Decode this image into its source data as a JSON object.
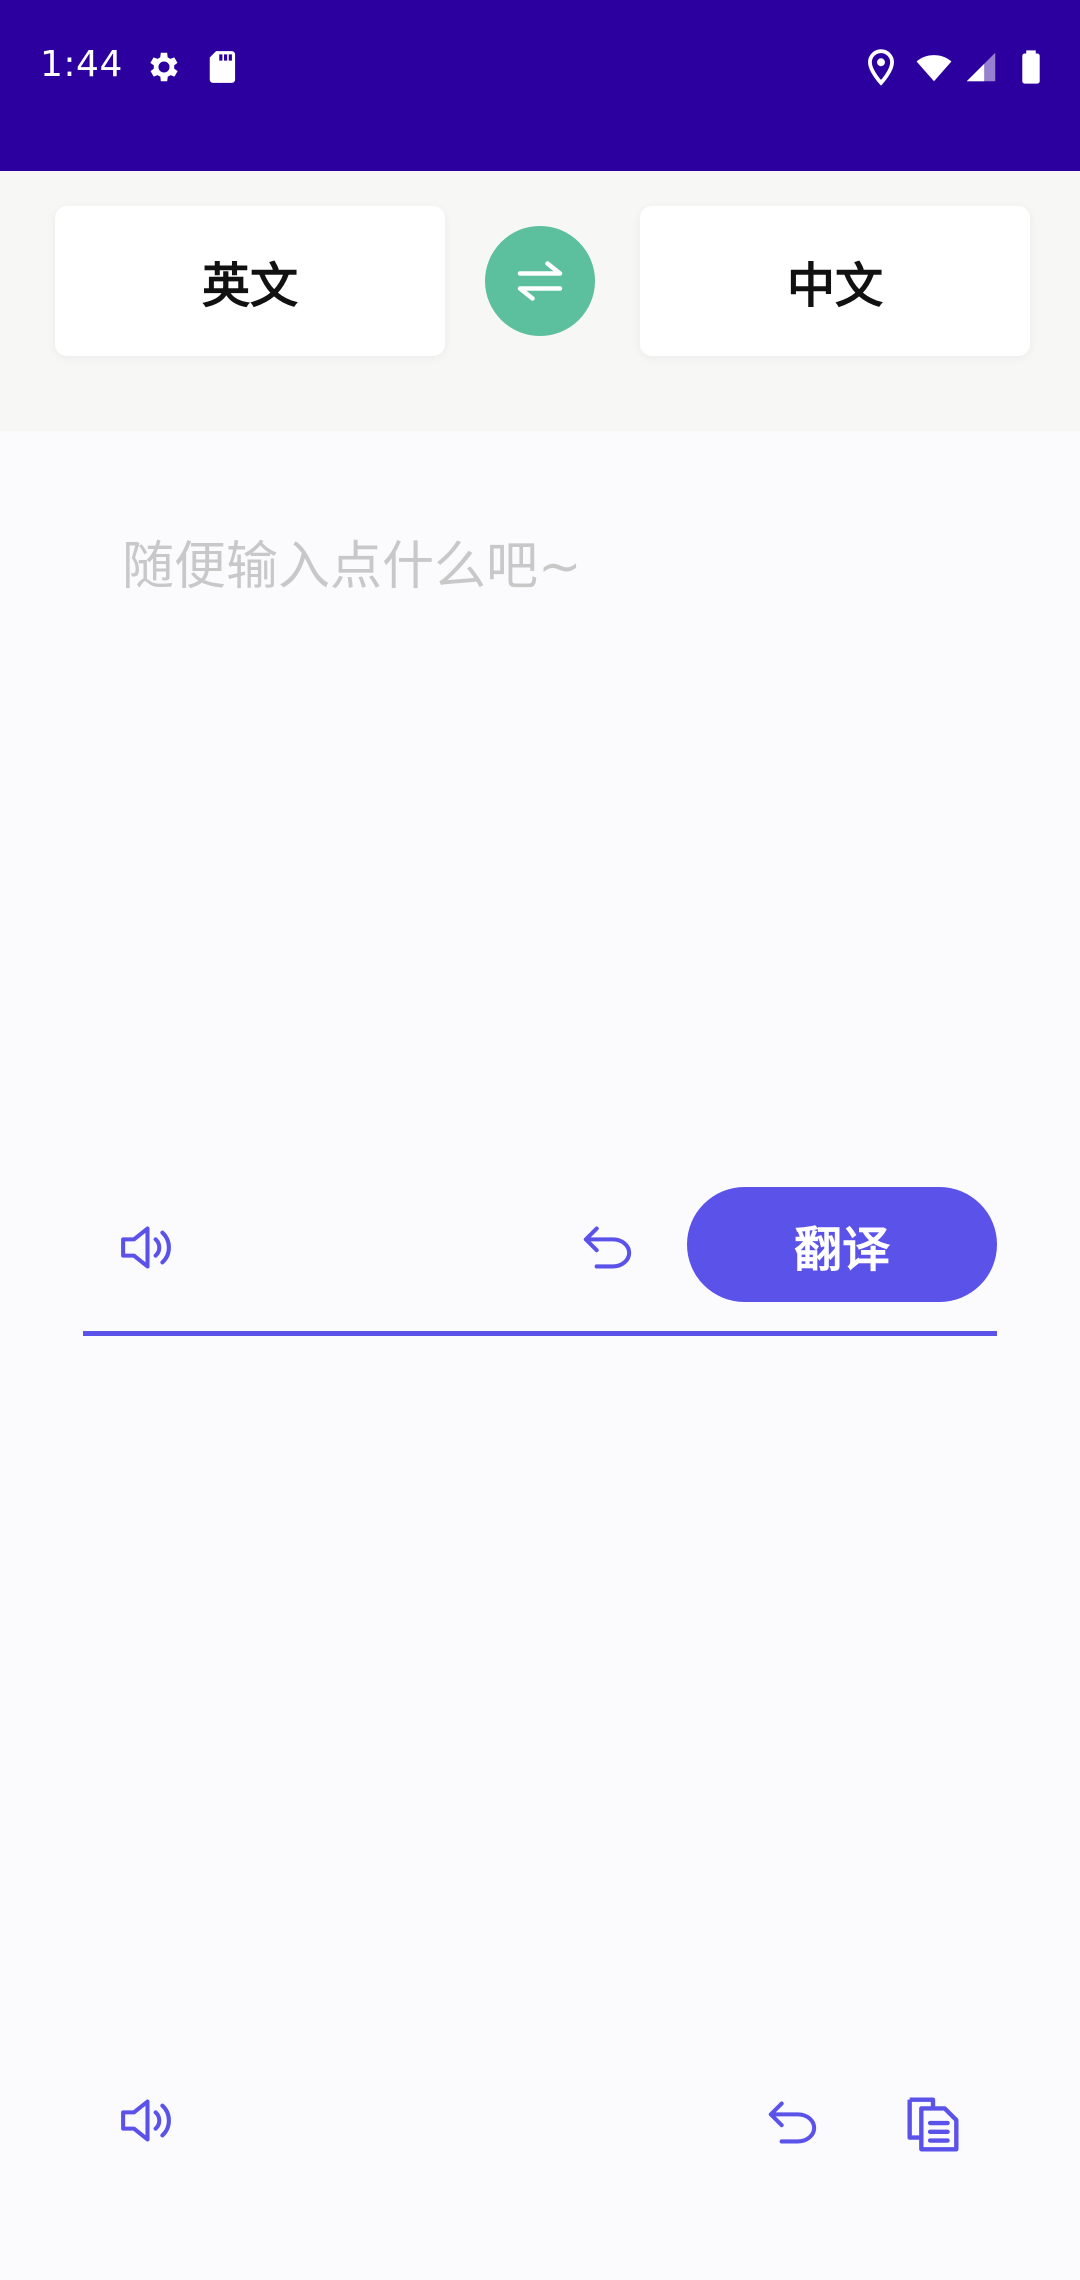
{
  "status_bar": {
    "time": "1:44",
    "icons": [
      "settings-icon",
      "sd-card-icon",
      "location-icon",
      "wifi-icon",
      "signal-icon",
      "battery-icon"
    ]
  },
  "languages": {
    "source": "英文",
    "target": "中文",
    "swap_icon": "swap-arrows-icon"
  },
  "input": {
    "placeholder": "随便输入点什么吧~",
    "value": ""
  },
  "input_toolbar": {
    "speak_icon": "speaker-icon",
    "undo_icon": "undo-icon",
    "translate_label": "翻译"
  },
  "output_toolbar": {
    "speak_icon": "speaker-icon",
    "undo_icon": "undo-icon",
    "copy_icon": "copy-icon"
  },
  "colors": {
    "status_bar": "#2c009e",
    "accent": "#5b52ea",
    "swap_button": "#5cbf9d",
    "background": "#fbfbfe"
  }
}
